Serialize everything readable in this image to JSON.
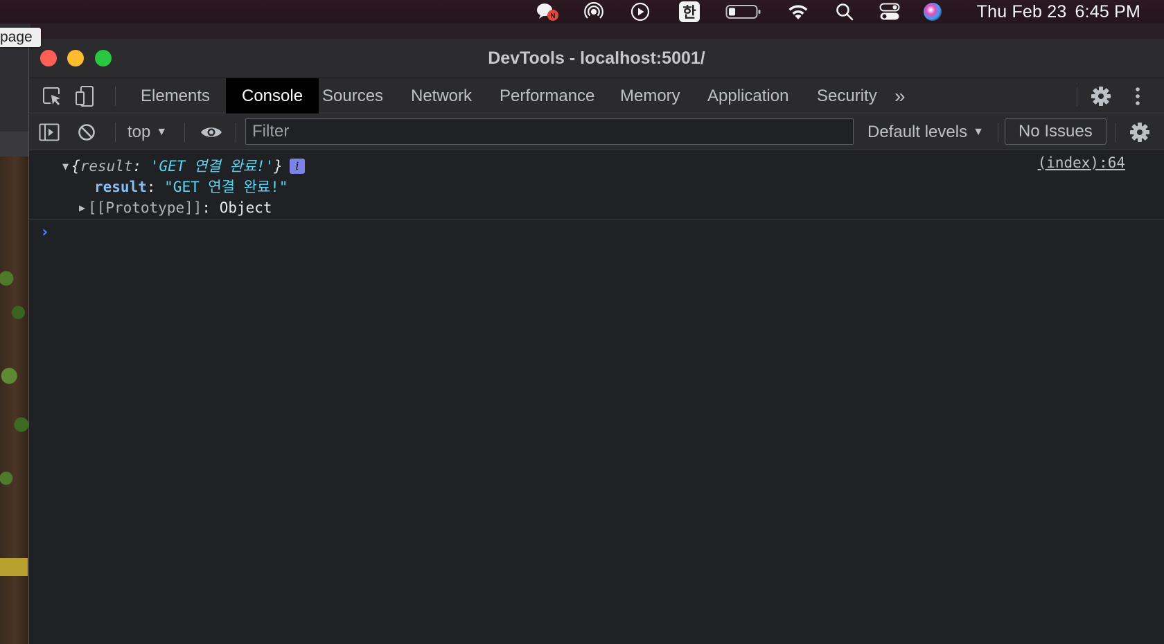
{
  "menubar": {
    "icons": [
      "chat-notification-icon",
      "airdrop-icon",
      "play-icon",
      "korean-ime-icon",
      "battery-icon",
      "wifi-icon",
      "spotlight-search-icon",
      "control-center-icon",
      "siri-icon"
    ],
    "ime_label": "한",
    "date": "Thu Feb 23",
    "time": "6:45 PM"
  },
  "background_app": {
    "tooltip": "page"
  },
  "window": {
    "title": "DevTools - localhost:5001/"
  },
  "tabs": {
    "items": [
      "Elements",
      "Console",
      "Sources",
      "Network",
      "Performance",
      "Memory",
      "Application",
      "Security"
    ],
    "active": "Console",
    "more_label": "»"
  },
  "console_toolbar": {
    "context": "top",
    "filter_placeholder": "Filter",
    "levels": "Default levels",
    "issues": "No Issues"
  },
  "console": {
    "entry": {
      "summary_open": "{",
      "summary_key": "result",
      "summary_colon": ": ",
      "summary_value": "'GET 연결 완료!'",
      "summary_close": "}",
      "info_badge": "i",
      "source": "(index):64",
      "prop_key": "result",
      "prop_colon": ": ",
      "prop_value": "\"GET 연결 완료!\"",
      "proto_key": "[[Prototype]]",
      "proto_colon": ": ",
      "proto_value": "Object"
    },
    "prompt_symbol": "›"
  },
  "colors": {
    "accent_prompt": "#4d90fe",
    "string_value": "#5cd5f0",
    "property_key": "#87bff5"
  }
}
